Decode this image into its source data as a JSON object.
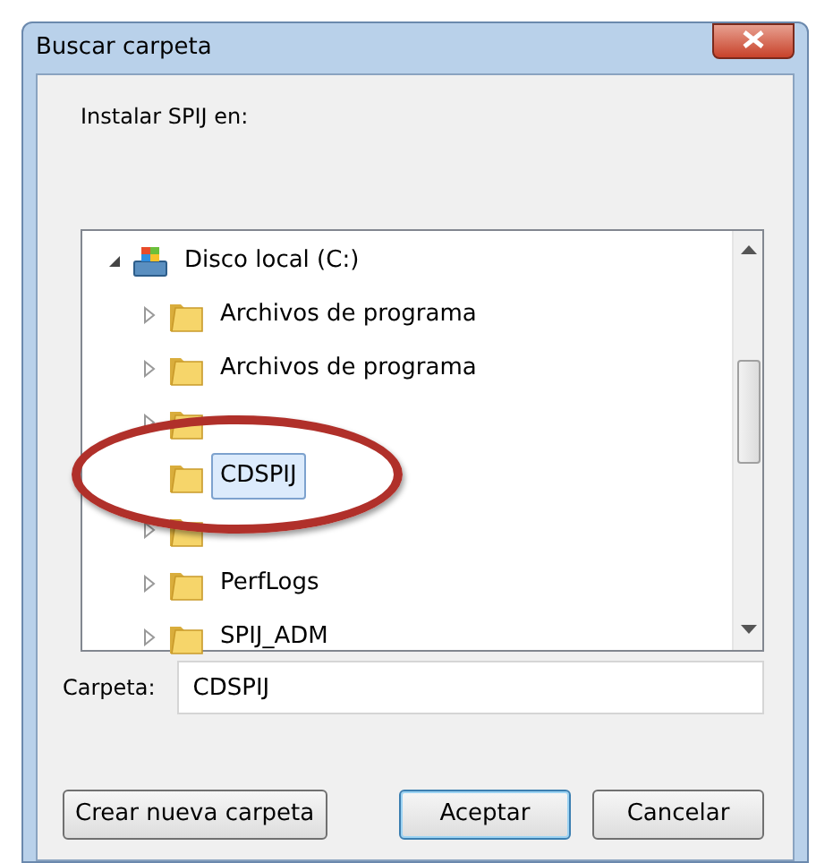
{
  "window": {
    "title": "Buscar carpeta"
  },
  "instruction": "Instalar SPIJ en:",
  "tree": [
    {
      "label": "Disco local (C:)",
      "kind": "drive",
      "expanded": true,
      "selected": false,
      "children": [
        {
          "label": "Archivos de programa",
          "kind": "folder",
          "expanded": false,
          "selected": false
        },
        {
          "label": "Archivos de programa",
          "kind": "folder",
          "expanded": false,
          "selected": false
        },
        {
          "kind": "folder",
          "expanded": false
        },
        {
          "label": "CDSPIJ",
          "kind": "folder",
          "selected": true
        },
        {
          "kind": "folder",
          "expanded": false
        },
        {
          "label": "PerfLogs",
          "kind": "folder",
          "expanded": false,
          "selected": false
        },
        {
          "label": "SPIJ_ADM",
          "kind": "folder",
          "expanded": false,
          "selected": false
        }
      ]
    }
  ],
  "folder_field": {
    "label": "Carpeta:",
    "value": "CDSPIJ"
  },
  "buttons": [
    {
      "label": "Crear nueva carpeta",
      "default": false
    },
    {
      "label": "Aceptar",
      "default": true
    },
    {
      "label": "Cancelar",
      "default": false
    }
  ]
}
